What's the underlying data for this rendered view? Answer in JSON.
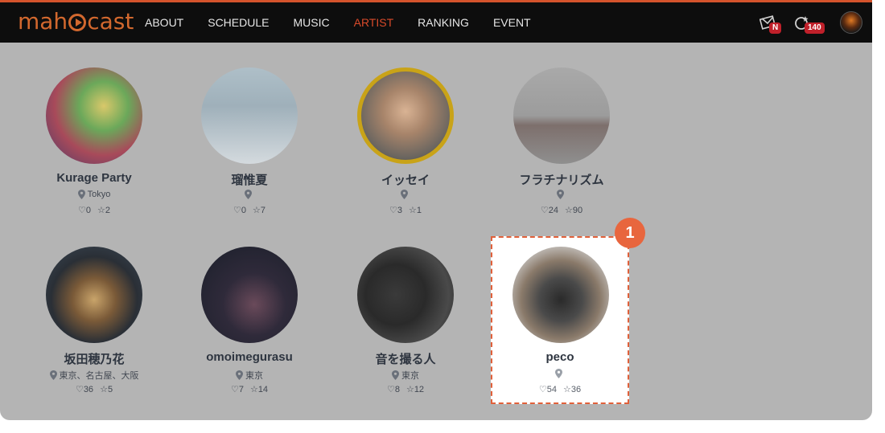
{
  "header": {
    "logo_text_left": "mah",
    "logo_text_right": "cast",
    "nav": [
      "ABOUT",
      "SCHEDULE",
      "MUSIC",
      "ARTIST",
      "RANKING",
      "EVENT"
    ],
    "active_nav": "ARTIST",
    "notification_badge": "N",
    "points_badge": "140"
  },
  "colors": {
    "accent": "#d94a2a",
    "navbar_bg": "#0d0d0d",
    "overlay": "#b4b4b4",
    "highlight_border": "#e0603a"
  },
  "artists": [
    {
      "name": "Kurage Party",
      "location": "Tokyo",
      "likes": "0",
      "stars": "2"
    },
    {
      "name": "瑠惟夏",
      "location": "",
      "likes": "0",
      "stars": "7"
    },
    {
      "name": "イッセイ",
      "location": "",
      "likes": "3",
      "stars": "1"
    },
    {
      "name": "フラチナリズム",
      "location": "",
      "likes": "24",
      "stars": "90"
    },
    {
      "name": "坂田穂乃花",
      "location": "東京、名古屋、大阪",
      "likes": "36",
      "stars": "5"
    },
    {
      "name": "omoimegurasu",
      "location": "東京",
      "likes": "7",
      "stars": "14"
    },
    {
      "name": "音を撮る人",
      "location": "東京",
      "likes": "8",
      "stars": "12"
    },
    {
      "name": "peco",
      "location": "",
      "likes": "54",
      "stars": "36"
    }
  ],
  "annotation": {
    "step": "1"
  }
}
